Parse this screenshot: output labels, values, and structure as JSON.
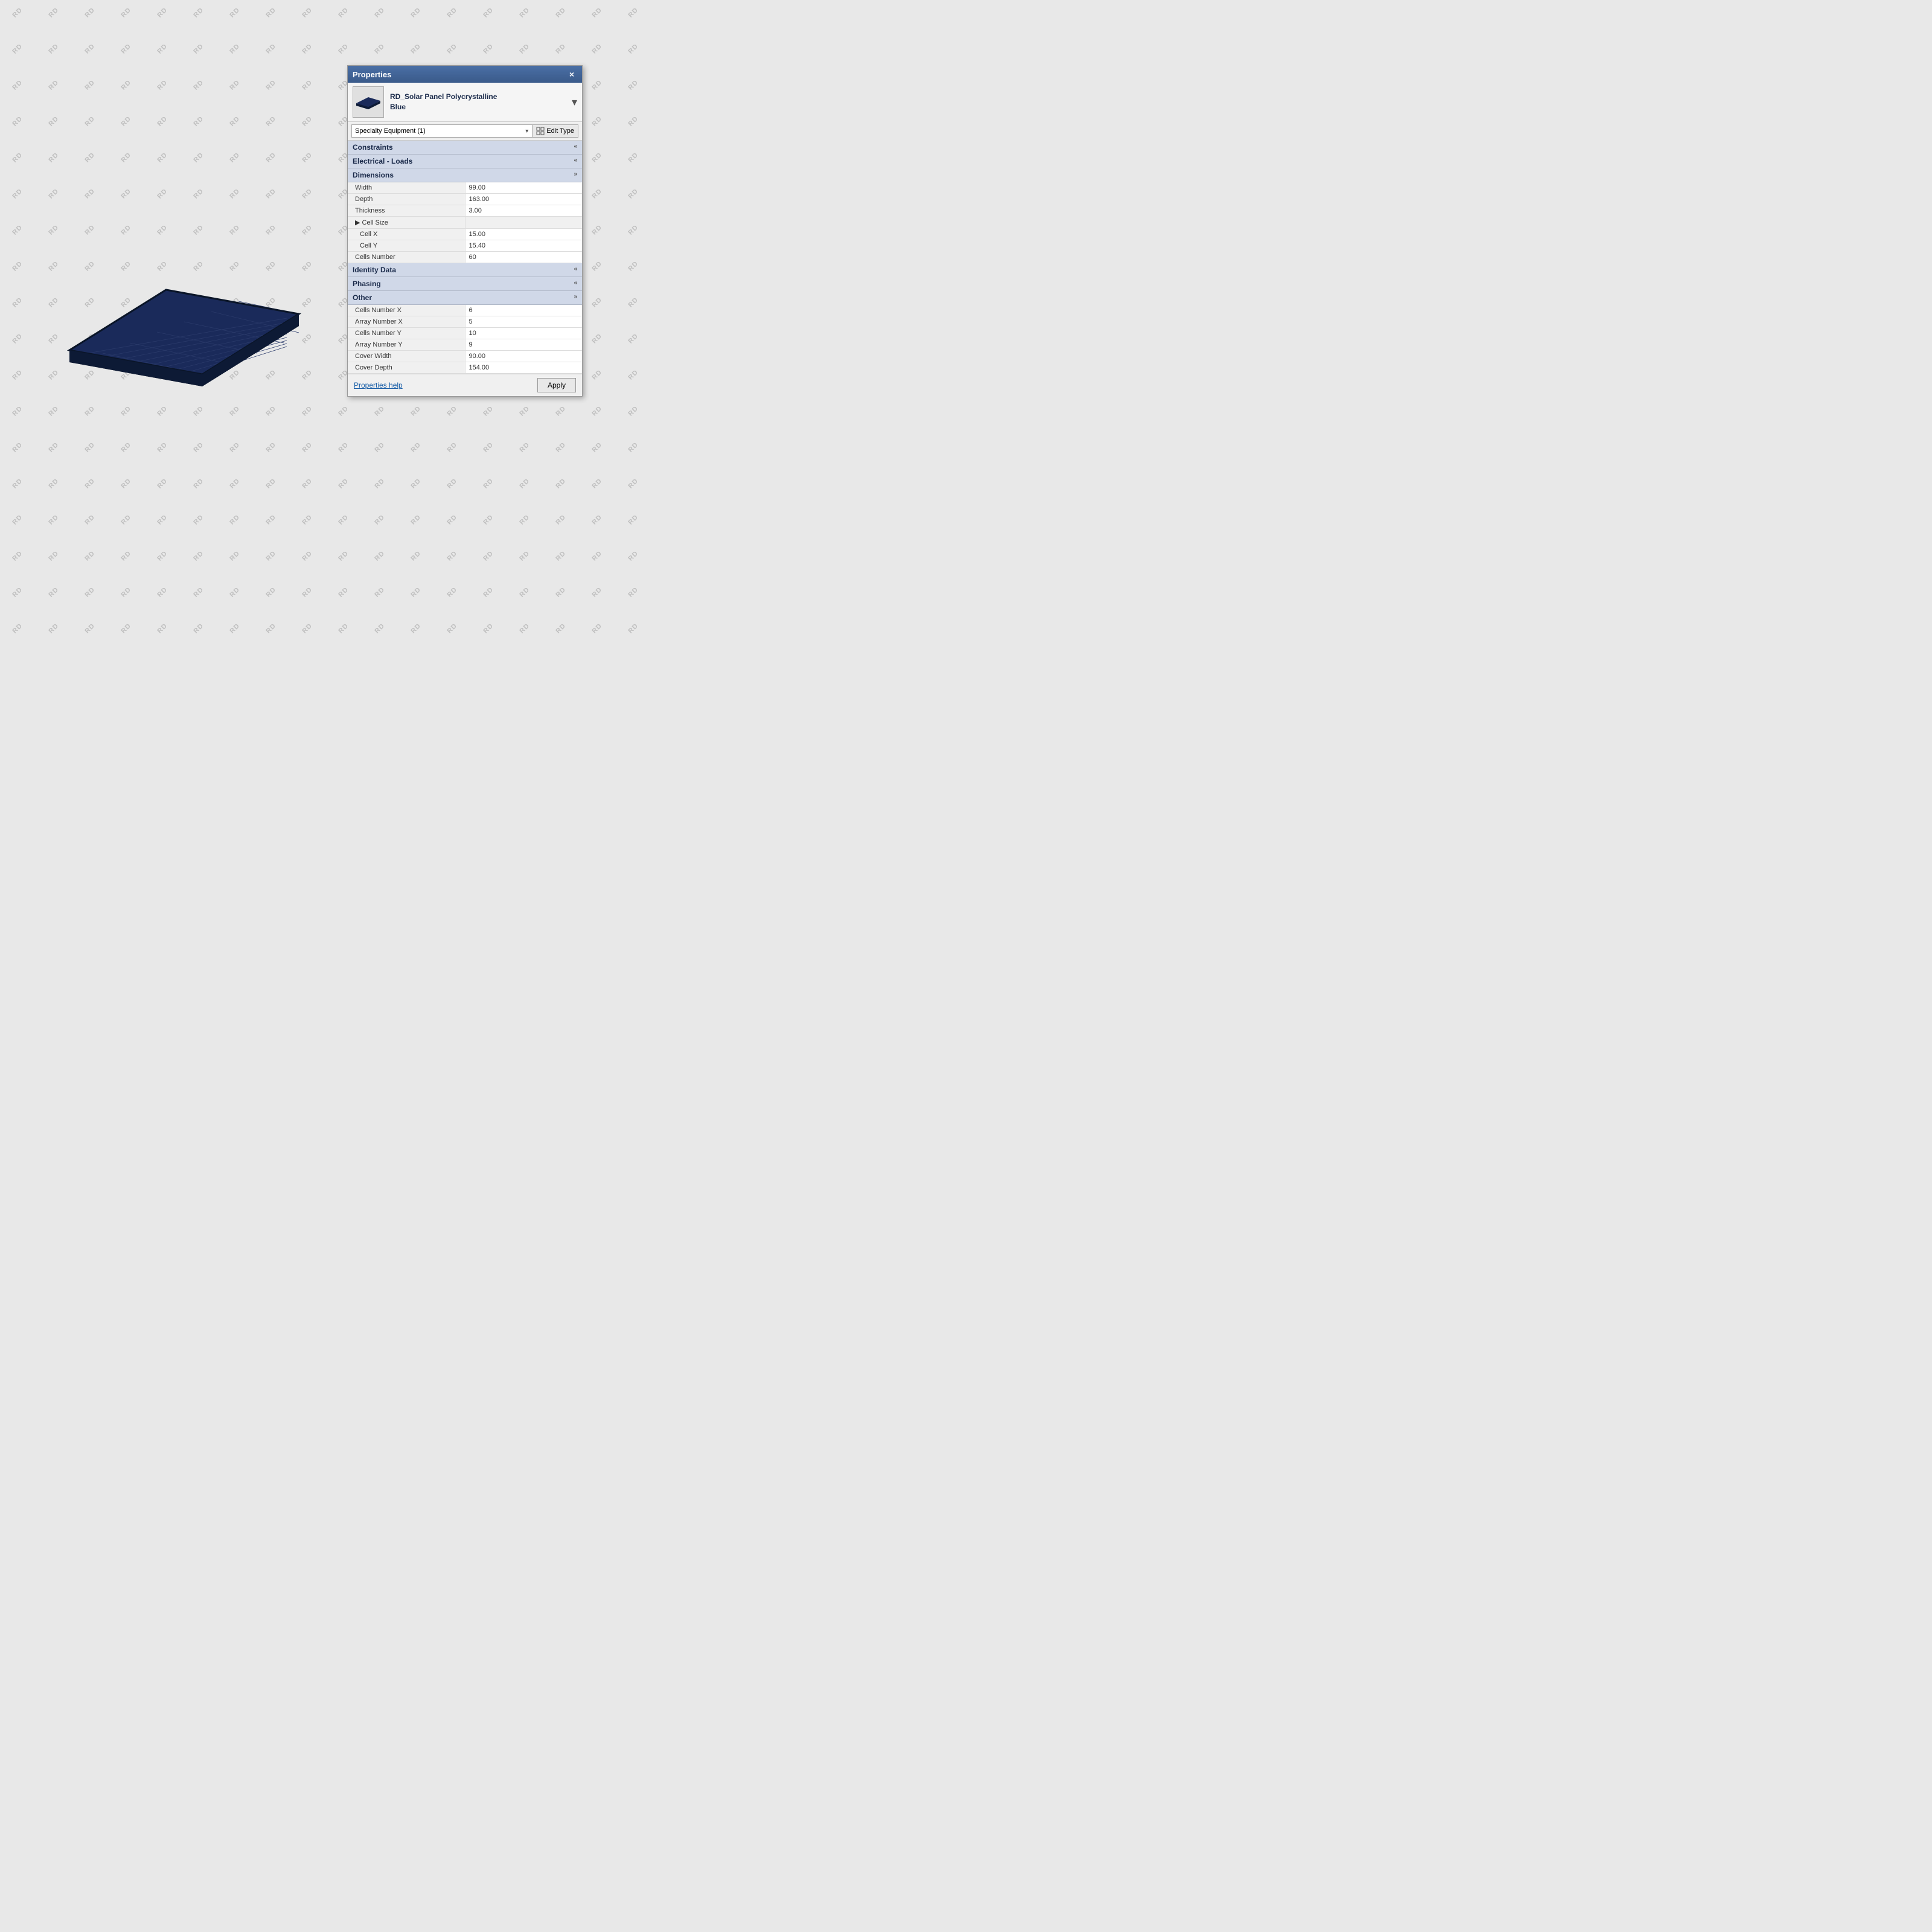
{
  "watermark": {
    "text": "RD"
  },
  "panel": {
    "title": "Properties",
    "close_label": "×",
    "component_name": "RD_Solar Panel Polycrystalline\nBlue",
    "component_name_line1": "RD_Solar Panel Polycrystalline",
    "component_name_line2": "Blue",
    "dropdown_value": "Specialty Equipment (1)",
    "edit_type_label": "Edit Type",
    "sections": [
      {
        "id": "constraints",
        "label": "Constraints",
        "collapsed": true,
        "rows": []
      },
      {
        "id": "electrical_loads",
        "label": "Electrical - Loads",
        "collapsed": true,
        "rows": []
      },
      {
        "id": "dimensions",
        "label": "Dimensions",
        "collapsed": false,
        "rows": [
          {
            "label": "Width",
            "value": "99.00",
            "editable": true,
            "indent": false
          },
          {
            "label": "Depth",
            "value": "163.00",
            "editable": true,
            "indent": false
          },
          {
            "label": "Thickness",
            "value": "3.00",
            "editable": true,
            "indent": false
          },
          {
            "label": "▶ Cell Size",
            "value": "",
            "editable": false,
            "indent": false
          },
          {
            "label": "Cell X",
            "value": "15.00",
            "editable": true,
            "indent": true
          },
          {
            "label": "Cell Y",
            "value": "15.40",
            "editable": true,
            "indent": true
          },
          {
            "label": "Cells Number",
            "value": "60",
            "editable": true,
            "indent": false
          }
        ]
      },
      {
        "id": "identity_data",
        "label": "Identity Data",
        "collapsed": true,
        "rows": []
      },
      {
        "id": "phasing",
        "label": "Phasing",
        "collapsed": true,
        "rows": []
      },
      {
        "id": "other",
        "label": "Other",
        "collapsed": false,
        "rows": [
          {
            "label": "Cells Number X",
            "value": "6",
            "editable": true,
            "indent": false
          },
          {
            "label": "Array Number X",
            "value": "5",
            "editable": true,
            "indent": false
          },
          {
            "label": "Cells Number Y",
            "value": "10",
            "editable": true,
            "indent": false
          },
          {
            "label": "Array Number Y",
            "value": "9",
            "editable": true,
            "indent": false
          },
          {
            "label": "Cover Width",
            "value": "90.00",
            "editable": true,
            "indent": false
          },
          {
            "label": "Cover Depth",
            "value": "154.00",
            "editable": true,
            "indent": false
          }
        ]
      }
    ],
    "footer": {
      "help_link": "Properties help",
      "apply_label": "Apply"
    }
  }
}
